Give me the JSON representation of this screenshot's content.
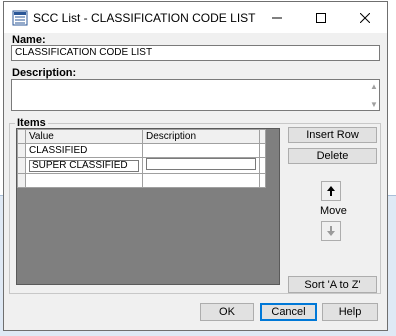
{
  "window": {
    "title": "SCC List - CLASSIFICATION CODE LIST",
    "icon": "list-app-icon",
    "controls": [
      "minimize-icon",
      "maximize-icon",
      "close-icon"
    ]
  },
  "form": {
    "name_label": "Name:",
    "name_value": "CLASSIFICATION CODE LIST",
    "description_label": "Description:",
    "description_value": ""
  },
  "items": {
    "group_label": "Items",
    "columns": [
      "Value",
      "Description"
    ],
    "rows": [
      {
        "value": "CLASSIFIED",
        "description": ""
      },
      {
        "value": "SUPER CLASSIFIED",
        "description": "",
        "editing": true
      }
    ]
  },
  "side_buttons": {
    "insert_row": "Insert Row",
    "delete": "Delete",
    "move_label": "Move",
    "sort": "Sort 'A to Z'"
  },
  "footer": {
    "ok": "OK",
    "cancel": "Cancel",
    "help": "Help"
  }
}
